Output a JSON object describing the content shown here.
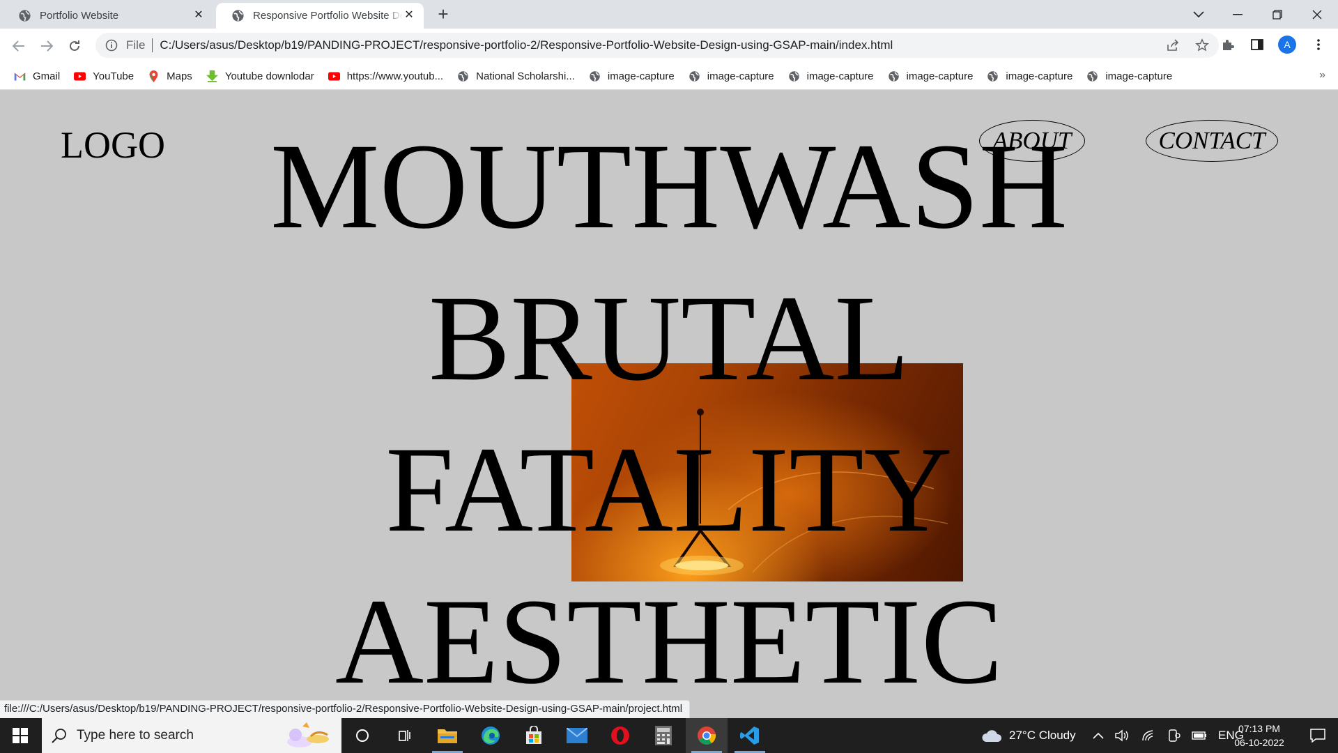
{
  "browser": {
    "tabs": [
      {
        "title": "Portfolio Website",
        "active": false
      },
      {
        "title": "Responsive Portfolio Website Design using GSAP",
        "active": true
      }
    ],
    "address": {
      "scheme": "File",
      "url": "C:/Users/asus/Desktop/b19/PANDING-PROJECT/responsive-portfolio-2/Responsive-Portfolio-Website-Design-using-GSAP-main/index.html"
    },
    "profile_initial": "A",
    "bookmarks": [
      {
        "label": "Gmail",
        "icon": "gmail-icon"
      },
      {
        "label": "YouTube",
        "icon": "youtube-icon"
      },
      {
        "label": "Maps",
        "icon": "maps-icon"
      },
      {
        "label": "Youtube downlodar",
        "icon": "download-icon"
      },
      {
        "label": "https://www.youtub...",
        "icon": "youtube-icon"
      },
      {
        "label": "National Scholarshi...",
        "icon": "globe-icon"
      },
      {
        "label": "image-capture",
        "icon": "globe-icon"
      },
      {
        "label": "image-capture",
        "icon": "globe-icon"
      },
      {
        "label": "image-capture",
        "icon": "globe-icon"
      },
      {
        "label": "image-capture",
        "icon": "globe-icon"
      },
      {
        "label": "image-capture",
        "icon": "globe-icon"
      },
      {
        "label": "image-capture",
        "icon": "globe-icon"
      }
    ],
    "more_bookmarks": "»",
    "status_url": "file:///C:/Users/asus/Desktop/b19/PANDING-PROJECT/responsive-portfolio-2/Responsive-Portfolio-Website-Design-using-GSAP-main/project.html"
  },
  "site": {
    "logo": "LOGO",
    "nav": {
      "about": "ABOUT",
      "contact": "CONTACT"
    },
    "hero_lines": [
      "MOUTHWASH",
      "BRUTAL",
      "FATALITY",
      "AESTHETIC"
    ],
    "hero_image_colors": [
      "#c04f06",
      "#7a2a02",
      "#ff9f1c"
    ]
  },
  "taskbar": {
    "search_placeholder": "Type here to search",
    "weather": "27°C  Cloudy",
    "language": "ENG",
    "time": "07:13 PM",
    "date": "06-10-2022"
  },
  "colors": {
    "page_background": "#c8c8c8",
    "tabstrip": "#dee1e6",
    "taskbar": "#1f1f1f",
    "accent": "#1a73e8"
  }
}
